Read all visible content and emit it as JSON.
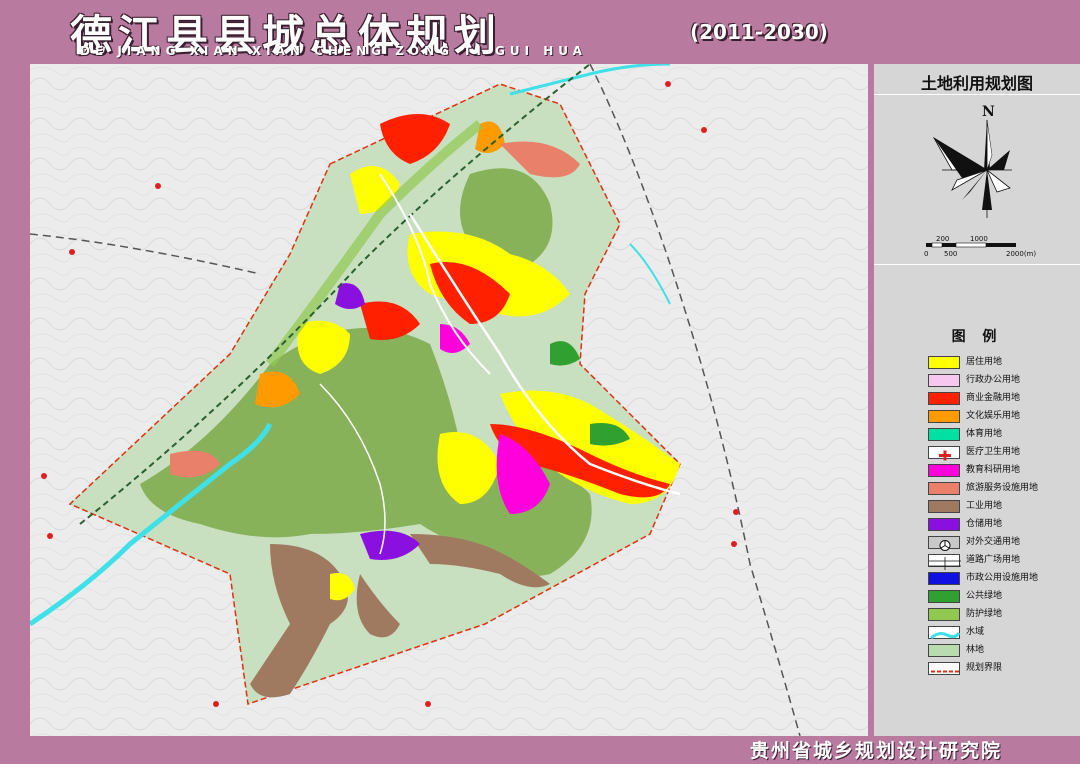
{
  "header": {
    "title_cn": "德江县县城总体规划",
    "title_pinyin": "DE JIANG XIAN XIAN CHENG ZONG TI GUI HUA",
    "years": "(2011-2030)"
  },
  "sidebar": {
    "map_title": "土地利用规划图",
    "north_label": "N",
    "scale": {
      "top_labels": [
        "200",
        "1000"
      ],
      "bottom_labels": [
        "0",
        "500",
        "2000(m)"
      ]
    },
    "legend_title": "图 例",
    "legend": [
      {
        "label": "居住用地",
        "color": "#ffff00",
        "icon": "fill"
      },
      {
        "label": "行政办公用地",
        "color": "#f6c8ee",
        "icon": "fill"
      },
      {
        "label": "商业金融用地",
        "color": "#ff2000",
        "icon": "fill"
      },
      {
        "label": "文化娱乐用地",
        "color": "#ff9a00",
        "icon": "fill"
      },
      {
        "label": "体育用地",
        "color": "#00e0a0",
        "icon": "fill"
      },
      {
        "label": "医疗卫生用地",
        "color": "#ffffff",
        "icon": "red-cross"
      },
      {
        "label": "教育科研用地",
        "color": "#ff00dd",
        "icon": "fill"
      },
      {
        "label": "旅游服务设施用地",
        "color": "#e8806a",
        "icon": "fill"
      },
      {
        "label": "工业用地",
        "color": "#a07a60",
        "icon": "fill"
      },
      {
        "label": "仓储用地",
        "color": "#8a10e0",
        "icon": "fill"
      },
      {
        "label": "对外交通用地",
        "color": "#c8c8c8",
        "icon": "transport-symbol"
      },
      {
        "label": "道路广场用地",
        "color": "#ffffff",
        "icon": "road-lines"
      },
      {
        "label": "市政公用设施用地",
        "color": "#1010e0",
        "icon": "fill"
      },
      {
        "label": "公共绿地",
        "color": "#30a030",
        "icon": "fill"
      },
      {
        "label": "防护绿地",
        "color": "#90c850",
        "icon": "fill"
      },
      {
        "label": "水域",
        "color": "#40e0e8",
        "icon": "water-line"
      },
      {
        "label": "林地",
        "color": "#b8dcb0",
        "icon": "fill"
      },
      {
        "label": "规划界限",
        "color": "#e03010",
        "icon": "dash-line"
      }
    ]
  },
  "footer": {
    "institute": "贵州省城乡规划设计研究院"
  }
}
